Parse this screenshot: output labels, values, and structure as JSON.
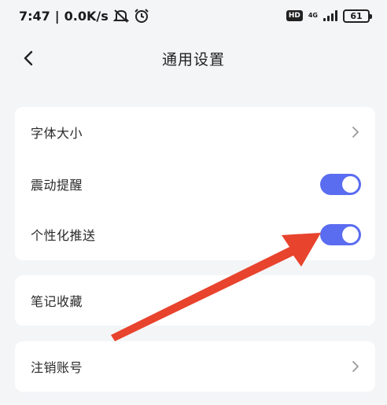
{
  "status_bar": {
    "time": "7:47",
    "separator": "|",
    "net_speed": "0.0K/s",
    "hd_label": "HD",
    "network_type": "4G",
    "battery": "61",
    "icons": [
      "mute-icon",
      "alarm-icon",
      "hd-icon",
      "signal-icon",
      "battery-icon"
    ]
  },
  "nav": {
    "title": "通用设置",
    "back_icon": "back-arrow-icon"
  },
  "settings": {
    "group1": {
      "font_size_label": "字体大小",
      "vibration_label": "震动提醒",
      "vibration_on": true,
      "push_label": "个性化推送",
      "push_on": true
    },
    "group2": {
      "note_fav_label": "笔记收藏"
    },
    "group3": {
      "cancel_account_label": "注销账号"
    }
  },
  "colors": {
    "toggle_on": "#5a6cf0",
    "annotation_arrow": "#e8432d",
    "background": "#f4f5f7"
  }
}
